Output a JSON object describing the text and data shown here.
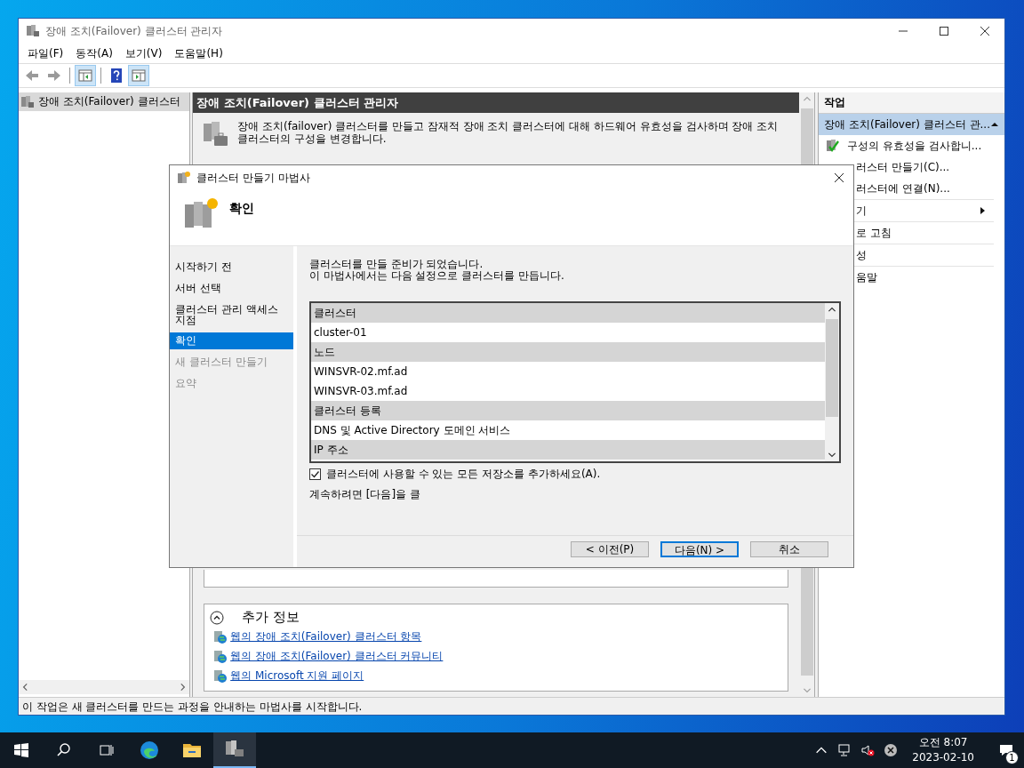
{
  "window": {
    "title": "장애 조치(Failover) 클러스터 관리자",
    "menu": [
      {
        "label": "파일(F)"
      },
      {
        "label": "동작(A)"
      },
      {
        "label": "보기(V)"
      },
      {
        "label": "도움말(H)"
      }
    ],
    "tree": {
      "items": [
        {
          "label": "장애 조치(Failover) 클러스터",
          "selected": true
        }
      ]
    },
    "center": {
      "header": "장애 조치(Failover) 클러스터 관리자",
      "description": "장애 조치(failover) 클러스터를 만들고 잠재적 장애 조치 클러스터에 대해 하드웨어 유효성을 검사하며 장애 조치 클러스터의 구성을 변경합니다.",
      "more_info": {
        "title": "추가 정보",
        "expanded": true,
        "links": [
          "웹의 장애 조치(Failover) 클러스터 항목",
          "웹의 장애 조치(Failover) 클러스터 커뮤니티",
          "웹의 Microsoft 지원 페이지"
        ]
      }
    },
    "actions": {
      "title": "작업",
      "group": "장애 조치(Failover) 클러스터 관...",
      "expanded": true,
      "items": [
        {
          "label": "구성의 유효성을 검사합니...",
          "kind": "command"
        },
        {
          "label": "러스터 만들기(C)...",
          "kind": "command"
        },
        {
          "label": "러스터에 연결(N)...",
          "kind": "command"
        },
        {
          "label": "기",
          "kind": "submenu"
        },
        {
          "label": "로 고침",
          "kind": "command"
        },
        {
          "label": "성",
          "kind": "command"
        },
        {
          "label": "움말",
          "kind": "command"
        }
      ]
    },
    "status_bar": "이 작업은 새 클러스터를 만드는 과정을 안내하는 마법사를 시작합니다."
  },
  "dialog": {
    "title": "클러스터 만들기 마법사",
    "heading": "확인",
    "steps": [
      {
        "label": "시작하기 전",
        "selected": false,
        "disabled": false
      },
      {
        "label": "서버 선택",
        "selected": false,
        "disabled": false
      },
      {
        "label": "클러스터 관리 액세스 지점",
        "selected": false,
        "disabled": false
      },
      {
        "label": "확인",
        "selected": true,
        "disabled": false
      },
      {
        "label": "새 클러스터 만들기",
        "selected": false,
        "disabled": true
      },
      {
        "label": "요약",
        "selected": false,
        "disabled": true
      }
    ],
    "intro": [
      "클러스터를 만들 준비가 되었습니다.",
      "이 마법사에서는 다음 설정으로 클러스터를 만듭니다."
    ],
    "settings": [
      {
        "kind": "header",
        "text": "클러스터"
      },
      {
        "kind": "value",
        "text": "cluster-01"
      },
      {
        "kind": "header",
        "text": "노드"
      },
      {
        "kind": "value",
        "text": "WINSVR-02.mf.ad"
      },
      {
        "kind": "value",
        "text": "WINSVR-03.mf.ad"
      },
      {
        "kind": "header",
        "text": "클러스터 등록"
      },
      {
        "kind": "value",
        "text": "DNS 및 Active Directory 도메인 서비스"
      },
      {
        "kind": "header",
        "text": "IP 주소"
      }
    ],
    "add_storage": {
      "label": "클러스터에 사용할 수 있는 모든 저장소를 추가하세요(A).",
      "checked": true
    },
    "continue_note": "계속하려면 [다음]을 클",
    "buttons": [
      {
        "label": "< 이전(P)",
        "default": false
      },
      {
        "label": "다음(N) >",
        "default": true
      },
      {
        "label": "취소",
        "default": false
      }
    ]
  },
  "taskbar": {
    "apps": [
      {
        "kind": "edge",
        "selected": false
      },
      {
        "kind": "explorer",
        "selected": false
      },
      {
        "kind": "cluster",
        "selected": true
      }
    ],
    "clock": {
      "time": "오전 8:07",
      "date": "2023-02-10"
    },
    "notifications": "1"
  }
}
